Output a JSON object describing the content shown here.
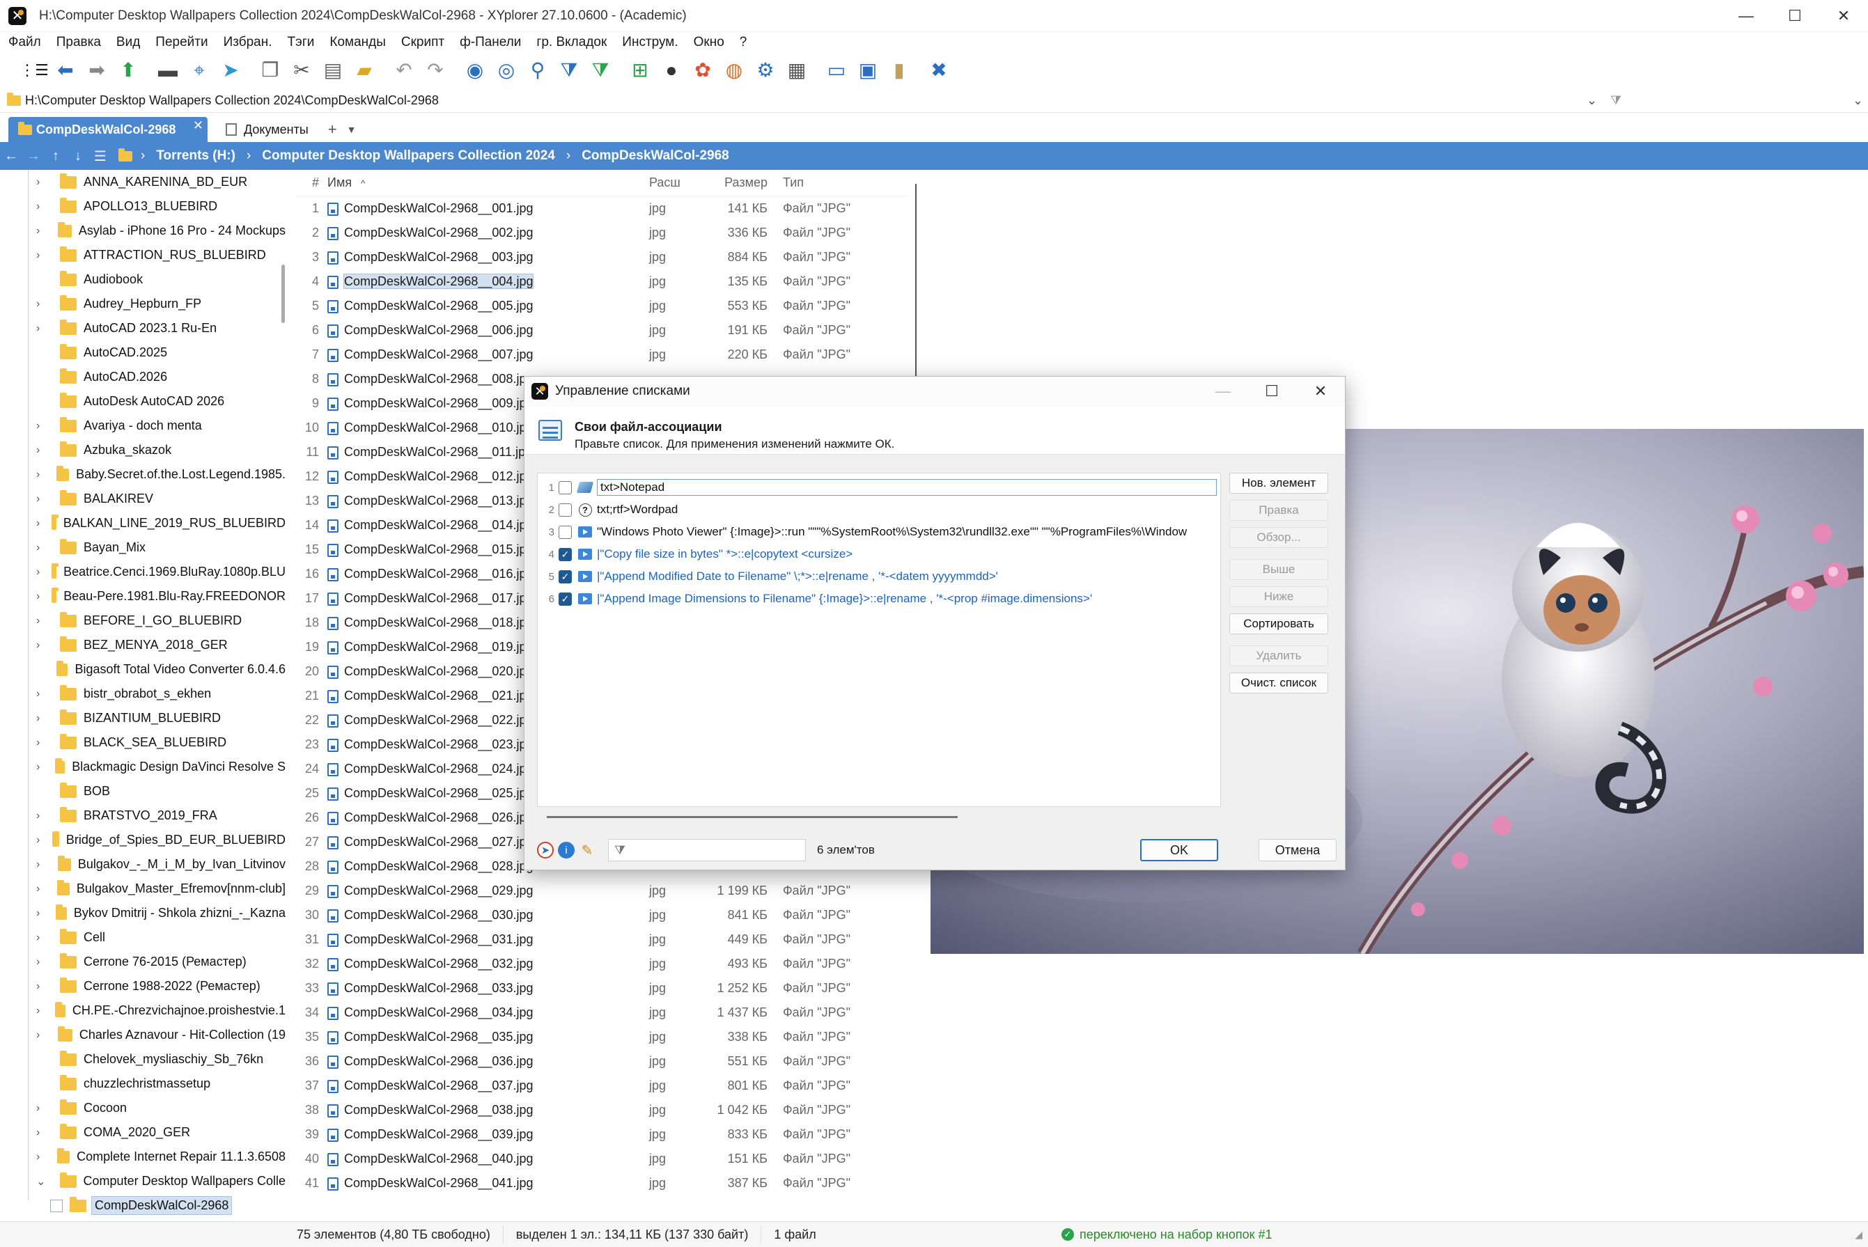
{
  "window": {
    "title": "H:\\Computer Desktop Wallpapers Collection 2024\\CompDeskWalCol-2968 - XYplorer 27.10.0600 - (Academic)",
    "minimize": "—",
    "maximize": "☐",
    "close": "✕"
  },
  "menu": [
    "Файл",
    "Правка",
    "Вид",
    "Перейти",
    "Избран.",
    "Тэги",
    "Команды",
    "Скрипт",
    "ф-Панели",
    "гр. Вкладок",
    "Инструм.",
    "Окно",
    "?"
  ],
  "toolbar_icons": [
    "menu-icon",
    "back-icon",
    "forward-icon",
    "up-icon",
    "computer-icon",
    "location-icon",
    "focus-icon",
    "copy-icon",
    "cut-icon",
    "paste-icon",
    "new-folder-icon",
    "undo-icon",
    "redo-icon",
    "play-icon",
    "find-icon",
    "search-icon",
    "filter-icon",
    "filter-green-icon",
    "tree-icon",
    "theme-icon",
    "color-icon",
    "ball-icon",
    "gear-icon",
    "grid-icon",
    "pane-horizontal-icon",
    "pane-layout-icon",
    "pane-vertical-icon",
    "tools-icon"
  ],
  "address": "H:\\Computer Desktop Wallpapers Collection 2024\\CompDeskWalCol-2968",
  "tabs": [
    {
      "label": "CompDeskWalCol-2968"
    },
    {
      "label": "Документы"
    }
  ],
  "tab_add": "+",
  "breadcrumb": [
    "Torrents (H:)",
    "Computer Desktop Wallpapers Collection 2024",
    "CompDeskWalCol-2968"
  ],
  "tree": [
    {
      "label": "ANNA_KARENINA_BD_EUR",
      "arrow": true
    },
    {
      "label": "APOLLO13_BLUEBIRD",
      "arrow": true
    },
    {
      "label": "Asylab - iPhone 16 Pro - 24 Mockups",
      "arrow": true
    },
    {
      "label": "ATTRACTION_RUS_BLUEBIRD",
      "arrow": true
    },
    {
      "label": "Audiobook",
      "arrow": false
    },
    {
      "label": "Audrey_Hepburn_FP",
      "arrow": true
    },
    {
      "label": "AutoCAD 2023.1 Ru-En",
      "arrow": true
    },
    {
      "label": "AutoCAD.2025",
      "arrow": false
    },
    {
      "label": "AutoCAD.2026",
      "arrow": false
    },
    {
      "label": "AutoDesk AutoCAD 2026",
      "arrow": false
    },
    {
      "label": "Avariya - doch menta",
      "arrow": true
    },
    {
      "label": "Azbuka_skazok",
      "arrow": true
    },
    {
      "label": "Baby.Secret.of.the.Lost.Legend.1985.",
      "arrow": true
    },
    {
      "label": "BALAKIREV",
      "arrow": true
    },
    {
      "label": "BALKAN_LINE_2019_RUS_BLUEBIRD",
      "arrow": true
    },
    {
      "label": "Bayan_Mix",
      "arrow": true
    },
    {
      "label": "Beatrice.Cenci.1969.BluRay.1080p.BLU",
      "arrow": true
    },
    {
      "label": "Beau-Pere.1981.Blu-Ray.FREEDONOR",
      "arrow": true
    },
    {
      "label": "BEFORE_I_GO_BLUEBIRD",
      "arrow": true
    },
    {
      "label": "BEZ_MENYA_2018_GER",
      "arrow": true
    },
    {
      "label": "Bigasoft Total Video Converter 6.0.4.6",
      "arrow": false
    },
    {
      "label": "bistr_obrabot_s_ekhen",
      "arrow": true
    },
    {
      "label": "BIZANTIUM_BLUEBIRD",
      "arrow": true
    },
    {
      "label": "BLACK_SEA_BLUEBIRD",
      "arrow": true
    },
    {
      "label": "Blackmagic Design DaVinci Resolve S",
      "arrow": true
    },
    {
      "label": "BOB",
      "arrow": false
    },
    {
      "label": "BRATSTVO_2019_FRA",
      "arrow": true
    },
    {
      "label": "Bridge_of_Spies_BD_EUR_BLUEBIRD",
      "arrow": true
    },
    {
      "label": "Bulgakov_-_M_i_M_by_Ivan_Litvinov",
      "arrow": true
    },
    {
      "label": "Bulgakov_Master_Efremov[nnm-club]",
      "arrow": true
    },
    {
      "label": "Bykov Dmitrij - Shkola zhizni_-_Kazna",
      "arrow": true
    },
    {
      "label": "Cell",
      "arrow": true
    },
    {
      "label": "Cerrone 76-2015 (Ремастер)",
      "arrow": true
    },
    {
      "label": "Cerrone 1988-2022 (Ремастер)",
      "arrow": true
    },
    {
      "label": "CH.PE.-Chrezvichajnoe.proishestvie.1",
      "arrow": true
    },
    {
      "label": "Charles Aznavour - Hit-Collection (19",
      "arrow": true
    },
    {
      "label": "Chelovek_mysliaschiy_Sb_76kn",
      "arrow": false
    },
    {
      "label": "chuzzlechristmassetup",
      "arrow": false
    },
    {
      "label": "Cocoon",
      "arrow": true
    },
    {
      "label": "COMA_2020_GER",
      "arrow": true
    },
    {
      "label": "Complete Internet Repair 11.1.3.6508",
      "arrow": true
    },
    {
      "label": "Computer Desktop Wallpapers Colle",
      "arrow": true
    }
  ],
  "tree_selected": "CompDeskWalCol-2968",
  "filelist": {
    "headers": {
      "num": "#",
      "name": "Имя",
      "ext": "Расш",
      "size": "Размер",
      "type": "Тип"
    },
    "sort_indicator": "^",
    "rows": [
      {
        "n": "1",
        "name": "CompDeskWalCol-2968__001.jpg",
        "ext": "jpg",
        "size": "141 КБ",
        "type": "Файл \"JPG\""
      },
      {
        "n": "2",
        "name": "CompDeskWalCol-2968__002.jpg",
        "ext": "jpg",
        "size": "336 КБ",
        "type": "Файл \"JPG\""
      },
      {
        "n": "3",
        "name": "CompDeskWalCol-2968__003.jpg",
        "ext": "jpg",
        "size": "884 КБ",
        "type": "Файл \"JPG\""
      },
      {
        "n": "4",
        "name": "CompDeskWalCol-2968__004.jpg",
        "ext": "jpg",
        "size": "135 КБ",
        "type": "Файл \"JPG\"",
        "selected": true
      },
      {
        "n": "5",
        "name": "CompDeskWalCol-2968__005.jpg",
        "ext": "jpg",
        "size": "553 КБ",
        "type": "Файл \"JPG\""
      },
      {
        "n": "6",
        "name": "CompDeskWalCol-2968__006.jpg",
        "ext": "jpg",
        "size": "191 КБ",
        "type": "Файл \"JPG\""
      },
      {
        "n": "7",
        "name": "CompDeskWalCol-2968__007.jpg",
        "ext": "jpg",
        "size": "220 КБ",
        "type": "Файл \"JPG\""
      },
      {
        "n": "8",
        "name": "CompDeskWalCol-2968__008.jpg",
        "ext": "",
        "size": "",
        "type": ""
      },
      {
        "n": "9",
        "name": "CompDeskWalCol-2968__009.jpg",
        "ext": "",
        "size": "",
        "type": ""
      },
      {
        "n": "10",
        "name": "CompDeskWalCol-2968__010.jpg",
        "ext": "",
        "size": "",
        "type": ""
      },
      {
        "n": "11",
        "name": "CompDeskWalCol-2968__011.jpg",
        "ext": "",
        "size": "",
        "type": ""
      },
      {
        "n": "12",
        "name": "CompDeskWalCol-2968__012.jpg",
        "ext": "",
        "size": "",
        "type": ""
      },
      {
        "n": "13",
        "name": "CompDeskWalCol-2968__013.jpg",
        "ext": "",
        "size": "",
        "type": ""
      },
      {
        "n": "14",
        "name": "CompDeskWalCol-2968__014.jpg",
        "ext": "",
        "size": "",
        "type": ""
      },
      {
        "n": "15",
        "name": "CompDeskWalCol-2968__015.jpg",
        "ext": "",
        "size": "",
        "type": ""
      },
      {
        "n": "16",
        "name": "CompDeskWalCol-2968__016.jpg",
        "ext": "",
        "size": "",
        "type": ""
      },
      {
        "n": "17",
        "name": "CompDeskWalCol-2968__017.jpg",
        "ext": "",
        "size": "",
        "type": ""
      },
      {
        "n": "18",
        "name": "CompDeskWalCol-2968__018.jpg",
        "ext": "",
        "size": "",
        "type": ""
      },
      {
        "n": "19",
        "name": "CompDeskWalCol-2968__019.jpg",
        "ext": "",
        "size": "",
        "type": ""
      },
      {
        "n": "20",
        "name": "CompDeskWalCol-2968__020.jpg",
        "ext": "",
        "size": "",
        "type": ""
      },
      {
        "n": "21",
        "name": "CompDeskWalCol-2968__021.jpg",
        "ext": "",
        "size": "",
        "type": ""
      },
      {
        "n": "22",
        "name": "CompDeskWalCol-2968__022.jpg",
        "ext": "",
        "size": "",
        "type": ""
      },
      {
        "n": "23",
        "name": "CompDeskWalCol-2968__023.jpg",
        "ext": "",
        "size": "",
        "type": ""
      },
      {
        "n": "24",
        "name": "CompDeskWalCol-2968__024.jpg",
        "ext": "",
        "size": "",
        "type": ""
      },
      {
        "n": "25",
        "name": "CompDeskWalCol-2968__025.jpg",
        "ext": "",
        "size": "",
        "type": ""
      },
      {
        "n": "26",
        "name": "CompDeskWalCol-2968__026.jpg",
        "ext": "",
        "size": "",
        "type": ""
      },
      {
        "n": "27",
        "name": "CompDeskWalCol-2968__027.jpg",
        "ext": "",
        "size": "",
        "type": ""
      },
      {
        "n": "28",
        "name": "CompDeskWalCol-2968__028.jpg",
        "ext": "",
        "size": "",
        "type": ""
      },
      {
        "n": "29",
        "name": "CompDeskWalCol-2968__029.jpg",
        "ext": "jpg",
        "size": "1 199 КБ",
        "type": "Файл \"JPG\""
      },
      {
        "n": "30",
        "name": "CompDeskWalCol-2968__030.jpg",
        "ext": "jpg",
        "size": "841 КБ",
        "type": "Файл \"JPG\""
      },
      {
        "n": "31",
        "name": "CompDeskWalCol-2968__031.jpg",
        "ext": "jpg",
        "size": "449 КБ",
        "type": "Файл \"JPG\""
      },
      {
        "n": "32",
        "name": "CompDeskWalCol-2968__032.jpg",
        "ext": "jpg",
        "size": "493 КБ",
        "type": "Файл \"JPG\""
      },
      {
        "n": "33",
        "name": "CompDeskWalCol-2968__033.jpg",
        "ext": "jpg",
        "size": "1 252 КБ",
        "type": "Файл \"JPG\""
      },
      {
        "n": "34",
        "name": "CompDeskWalCol-2968__034.jpg",
        "ext": "jpg",
        "size": "1 437 КБ",
        "type": "Файл \"JPG\""
      },
      {
        "n": "35",
        "name": "CompDeskWalCol-2968__035.jpg",
        "ext": "jpg",
        "size": "338 КБ",
        "type": "Файл \"JPG\""
      },
      {
        "n": "36",
        "name": "CompDeskWalCol-2968__036.jpg",
        "ext": "jpg",
        "size": "551 КБ",
        "type": "Файл \"JPG\""
      },
      {
        "n": "37",
        "name": "CompDeskWalCol-2968__037.jpg",
        "ext": "jpg",
        "size": "801 КБ",
        "type": "Файл \"JPG\""
      },
      {
        "n": "38",
        "name": "CompDeskWalCol-2968__038.jpg",
        "ext": "jpg",
        "size": "1 042 КБ",
        "type": "Файл \"JPG\""
      },
      {
        "n": "39",
        "name": "CompDeskWalCol-2968__039.jpg",
        "ext": "jpg",
        "size": "833 КБ",
        "type": "Файл \"JPG\""
      },
      {
        "n": "40",
        "name": "CompDeskWalCol-2968__040.jpg",
        "ext": "jpg",
        "size": "151 КБ",
        "type": "Файл \"JPG\""
      },
      {
        "n": "41",
        "name": "CompDeskWalCol-2968__041.jpg",
        "ext": "jpg",
        "size": "387 КБ",
        "type": "Файл \"JPG\""
      }
    ]
  },
  "status": {
    "items": "75 элементов (4,80 ТБ свободно)",
    "selected": "выделен 1 эл.: 134,11 КБ (137 330 байт)",
    "files": "1 файл",
    "message": "переключено на набор кнопок #1",
    "ok_mark": "✓"
  },
  "dialog": {
    "title": "Управление списками",
    "minimize": "—",
    "maximize": "☐",
    "close": "✕",
    "heading": "Свои файл-ассоциации",
    "subheading": "Правьте список. Для применения изменений нажмите ОК.",
    "rows": [
      {
        "n": "1",
        "checked": false,
        "icon": "notepad-icon",
        "text": "txt>Notepad",
        "editing": true,
        "blue": false
      },
      {
        "n": "2",
        "checked": false,
        "icon": "question-icon",
        "text": "txt;rtf>Wordpad",
        "blue": false
      },
      {
        "n": "3",
        "checked": false,
        "icon": "script-icon",
        "text": "\"Windows Photo Viewer\" {:Image}>::run \"\"\"%SystemRoot%\\System32\\rundll32.exe\"\" \"\"%ProgramFiles%\\Window",
        "blue": false
      },
      {
        "n": "4",
        "checked": true,
        "icon": "script-icon",
        "text": "|\"Copy file size in bytes\" *>::e|copytext <cursize>",
        "blue": true
      },
      {
        "n": "5",
        "checked": true,
        "icon": "script-icon",
        "text": "|\"Append Modified Date to Filename\" \\;*>::e|rename , '*-<datem yyyymmdd>'",
        "blue": true
      },
      {
        "n": "6",
        "checked": true,
        "icon": "script-icon",
        "text": "|\"Append Image Dimensions to Filename\" {:Image}>::e|rename , '*-<prop #image.dimensions>'",
        "blue": true
      }
    ],
    "buttons": [
      {
        "label": "Нов. элемент",
        "enabled": true
      },
      {
        "label": "Правка",
        "enabled": false
      },
      {
        "label": "Обзор...",
        "enabled": false
      },
      {
        "label": "Выше",
        "enabled": false,
        "gap": true
      },
      {
        "label": "Ниже",
        "enabled": false
      },
      {
        "label": "Сортировать",
        "enabled": true
      },
      {
        "label": "Удалить",
        "enabled": false,
        "gap": true
      },
      {
        "label": "Очист. список",
        "enabled": true
      }
    ],
    "count": "6 элем'тов",
    "filter_placeholder": "",
    "ok": "OK",
    "cancel": "Отмена"
  },
  "colors": {
    "accent": "#4a87cf",
    "folder": "#f6c445",
    "link_blue": "#1f63b8",
    "check": "#1f5a8f"
  }
}
